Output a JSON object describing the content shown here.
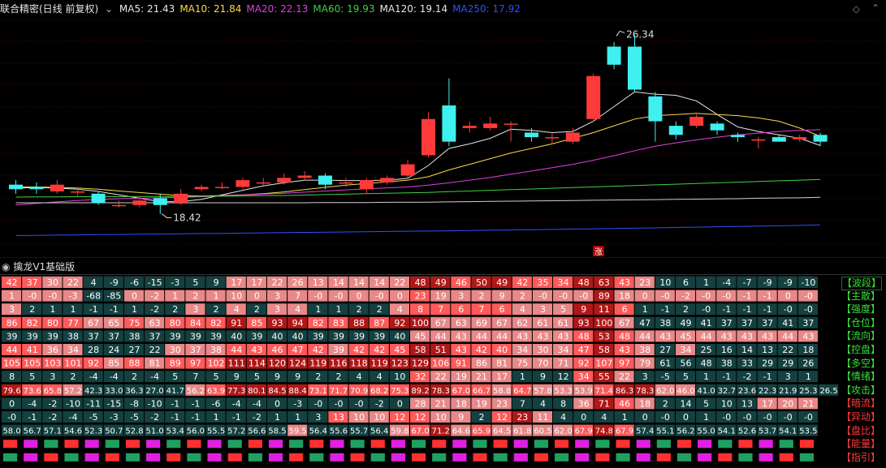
{
  "header": {
    "title": "联合精密(日线 前复权)",
    "ma": [
      {
        "label": "MA5: 21.43",
        "color": "#e6e6e6"
      },
      {
        "label": "MA10: 21.84",
        "color": "#ffd84a"
      },
      {
        "label": "MA20: 22.13",
        "color": "#e040e0"
      },
      {
        "label": "MA60: 19.93",
        "color": "#40d040"
      },
      {
        "label": "MA120: 19.14",
        "color": "#e6e6e6"
      },
      {
        "label": "MA250: 17.92",
        "color": "#3050ff"
      }
    ]
  },
  "chart_data": {
    "type": "candlestick",
    "price_range": [
      17.0,
      27.0
    ],
    "annotations": {
      "high": "26.34",
      "low": "18.42",
      "zhang": "涨"
    },
    "colors": {
      "up": "#ff3a3a",
      "down": "#3ff0f0"
    },
    "candles": [
      [
        19.7,
        19.5,
        19.9,
        19.3
      ],
      [
        19.6,
        19.5,
        19.8,
        19.3
      ],
      [
        19.4,
        19.7,
        19.9,
        19.3
      ],
      [
        19.4,
        19.4,
        19.6,
        19.2
      ],
      [
        19.3,
        18.9,
        19.4,
        18.8
      ],
      [
        18.8,
        18.8,
        19.0,
        18.7
      ],
      [
        18.8,
        19.0,
        19.2,
        18.7
      ],
      [
        19.1,
        18.8,
        19.3,
        18.4
      ],
      [
        18.9,
        19.3,
        19.5,
        18.8
      ],
      [
        19.5,
        19.6,
        19.7,
        19.4
      ],
      [
        19.6,
        19.6,
        19.8,
        19.5
      ],
      [
        19.6,
        19.9,
        20.0,
        19.5
      ],
      [
        19.8,
        19.8,
        20.0,
        19.6
      ],
      [
        19.8,
        20.0,
        20.2,
        19.7
      ],
      [
        20.0,
        20.1,
        20.3,
        19.9
      ],
      [
        20.1,
        19.7,
        20.2,
        19.5
      ],
      [
        19.8,
        19.8,
        20.0,
        19.6
      ],
      [
        19.5,
        19.9,
        20.0,
        19.3
      ],
      [
        19.8,
        20.0,
        20.1,
        19.7
      ],
      [
        20.1,
        20.6,
        20.8,
        20.0
      ],
      [
        21.0,
        22.6,
        22.9,
        20.9
      ],
      [
        23.2,
        21.6,
        24.4,
        21.4
      ],
      [
        22.2,
        22.3,
        22.5,
        22.0
      ],
      [
        22.2,
        22.4,
        22.7,
        22.1
      ],
      [
        22.4,
        22.4,
        22.5,
        21.6
      ],
      [
        22.0,
        21.8,
        22.2,
        21.6
      ],
      [
        21.8,
        21.8,
        22.0,
        21.5
      ],
      [
        21.6,
        22.0,
        22.2,
        21.5
      ],
      [
        22.6,
        24.5,
        24.6,
        22.5
      ],
      [
        25.8,
        25.0,
        26.0,
        24.8
      ],
      [
        25.8,
        23.9,
        26.3,
        23.8
      ],
      [
        23.6,
        22.5,
        23.8,
        21.6
      ],
      [
        22.3,
        21.9,
        22.5,
        21.7
      ],
      [
        22.3,
        22.7,
        22.8,
        22.2
      ],
      [
        22.4,
        22.1,
        22.5,
        21.9
      ],
      [
        21.9,
        21.8,
        22.0,
        21.6
      ],
      [
        21.7,
        21.7,
        21.8,
        21.3
      ],
      [
        21.8,
        21.6,
        21.9,
        21.6
      ],
      [
        21.7,
        21.8,
        21.9,
        21.6
      ],
      [
        21.9,
        21.6,
        22.0,
        21.4
      ]
    ],
    "ma_series": [
      {
        "name": "MA5",
        "color": "#e6e6e6",
        "values": [
          19.55,
          19.57,
          19.55,
          19.5,
          19.4,
          19.25,
          19.1,
          18.95,
          18.95,
          19.05,
          19.25,
          19.45,
          19.65,
          19.78,
          19.9,
          19.9,
          19.88,
          19.88,
          19.9,
          19.98,
          20.55,
          21.3,
          21.5,
          21.75,
          22.15,
          22.1,
          22.0,
          22.05,
          22.5,
          23.15,
          23.8,
          23.7,
          23.65,
          23.4,
          22.8,
          22.25,
          22.05,
          21.9,
          21.75,
          21.43
        ]
      },
      {
        "name": "MA10",
        "color": "#ffd84a",
        "values": [
          19.6,
          19.6,
          19.58,
          19.55,
          19.5,
          19.42,
          19.35,
          19.28,
          19.22,
          19.2,
          19.22,
          19.25,
          19.3,
          19.38,
          19.48,
          19.58,
          19.68,
          19.75,
          19.82,
          19.9,
          20.05,
          20.35,
          20.6,
          20.85,
          21.1,
          21.3,
          21.5,
          21.75,
          22.0,
          22.3,
          22.6,
          22.75,
          22.8,
          22.85,
          22.8,
          22.75,
          22.65,
          22.5,
          22.2,
          21.84
        ]
      },
      {
        "name": "MA20",
        "color": "#e040e0",
        "values": [
          18.8,
          18.87,
          18.94,
          19.0,
          19.05,
          19.08,
          19.1,
          19.12,
          19.14,
          19.17,
          19.2,
          19.24,
          19.28,
          19.32,
          19.37,
          19.42,
          19.47,
          19.52,
          19.56,
          19.6,
          19.68,
          19.78,
          19.9,
          20.02,
          20.16,
          20.3,
          20.45,
          20.6,
          20.78,
          20.98,
          21.2,
          21.4,
          21.55,
          21.68,
          21.8,
          21.9,
          21.98,
          22.05,
          22.1,
          22.13
        ]
      },
      {
        "name": "MA60",
        "color": "#40d040",
        "values": [
          19.15,
          19.16,
          19.16,
          19.17,
          19.17,
          19.17,
          19.18,
          19.18,
          19.18,
          19.19,
          19.19,
          19.2,
          19.21,
          19.22,
          19.24,
          19.26,
          19.28,
          19.3,
          19.32,
          19.34,
          19.36,
          19.39,
          19.42,
          19.45,
          19.48,
          19.51,
          19.54,
          19.57,
          19.6,
          19.63,
          19.66,
          19.69,
          19.72,
          19.75,
          19.78,
          19.81,
          19.84,
          19.87,
          19.9,
          19.93
        ]
      },
      {
        "name": "MA120",
        "color": "#cfcfcf",
        "values": [
          18.9,
          18.9,
          18.9,
          18.9,
          18.9,
          18.9,
          18.9,
          18.9,
          18.9,
          18.9,
          18.9,
          18.9,
          18.9,
          18.9,
          18.9,
          18.91,
          18.91,
          18.91,
          18.92,
          18.92,
          18.93,
          18.94,
          18.95,
          18.96,
          18.97,
          18.98,
          18.99,
          19.0,
          19.01,
          19.02,
          19.03,
          19.04,
          19.05,
          19.06,
          19.07,
          19.08,
          19.1,
          19.11,
          19.12,
          19.14
        ]
      },
      {
        "name": "MA250",
        "color": "#3050ff",
        "values": [
          17.45,
          17.46,
          17.47,
          17.48,
          17.49,
          17.5,
          17.51,
          17.52,
          17.53,
          17.54,
          17.55,
          17.56,
          17.57,
          17.58,
          17.59,
          17.6,
          17.61,
          17.62,
          17.63,
          17.64,
          17.65,
          17.66,
          17.67,
          17.69,
          17.7,
          17.71,
          17.72,
          17.74,
          17.75,
          17.76,
          17.78,
          17.79,
          17.81,
          17.82,
          17.84,
          17.85,
          17.87,
          17.88,
          17.9,
          17.92
        ]
      }
    ]
  },
  "indicator": {
    "title": "擒龙V1基础版",
    "rows": [
      {
        "label": "【波段】",
        "color": "#3adf3a",
        "values": [
          "42",
          "37",
          "30",
          "22",
          "4",
          "-9",
          "-6",
          "-15",
          "-3",
          "5",
          "9",
          "17",
          "17",
          "22",
          "26",
          "13",
          "14",
          "14",
          "14",
          "22",
          "48",
          "49",
          "46",
          "50",
          "49",
          "42",
          "35",
          "34",
          "48",
          "63",
          "43",
          "23",
          "10",
          "6",
          "1",
          "-4",
          "-7",
          "-9",
          "-9",
          "-10"
        ]
      },
      {
        "label": "【主散】",
        "color": "#3adf3a",
        "values": [
          "1",
          "-0",
          "-0",
          "-3",
          "-68",
          "-85",
          "0",
          "-2",
          "1",
          "2",
          "1",
          "10",
          "0",
          "3",
          "7",
          "-0",
          "-0",
          "0",
          "-0",
          "0",
          "23",
          "19",
          "3",
          "2",
          "9",
          "2",
          "-0",
          "-0",
          "-0",
          "89",
          "18",
          "0",
          "-0",
          "-2",
          "-0",
          "-0",
          "-1",
          "-1",
          "0",
          "-0"
        ]
      },
      {
        "label": "【强度】",
        "color": "#3adf3a",
        "values": [
          "3",
          "2",
          "1",
          "1",
          "-1",
          "-1",
          "1",
          "-2",
          "2",
          "3",
          "2",
          "4",
          "2",
          "3",
          "4",
          "1",
          "1",
          "2",
          "2",
          "4",
          "8",
          "7",
          "6",
          "7",
          "6",
          "4",
          "3",
          "5",
          "9",
          "11",
          "6",
          "1",
          "-1",
          "2",
          "-0",
          "-1",
          "-1",
          "-1",
          "-0",
          "-0"
        ]
      },
      {
        "label": "【仓位】",
        "color": "#3adf3a",
        "values": [
          "86",
          "82",
          "80",
          "77",
          "67",
          "65",
          "75",
          "63",
          "80",
          "84",
          "82",
          "91",
          "85",
          "93",
          "94",
          "82",
          "83",
          "88",
          "87",
          "92",
          "100",
          "67",
          "63",
          "69",
          "67",
          "62",
          "61",
          "61",
          "93",
          "100",
          "67",
          "47",
          "38",
          "49",
          "41",
          "37",
          "37",
          "37",
          "41",
          "37"
        ]
      },
      {
        "label": "【流向】",
        "color": "#3adf3a",
        "values": [
          "39",
          "39",
          "39",
          "38",
          "37",
          "37",
          "38",
          "37",
          "39",
          "39",
          "39",
          "40",
          "39",
          "40",
          "40",
          "39",
          "39",
          "39",
          "39",
          "40",
          "45",
          "44",
          "43",
          "44",
          "44",
          "43",
          "43",
          "43",
          "48",
          "53",
          "48",
          "44",
          "43",
          "45",
          "44",
          "43",
          "43",
          "43",
          "44",
          "43"
        ]
      },
      {
        "label": "【控盘】",
        "color": "#3adf3a",
        "values": [
          "44",
          "41",
          "36",
          "34",
          "28",
          "24",
          "27",
          "22",
          "30",
          "37",
          "38",
          "44",
          "43",
          "46",
          "47",
          "42",
          "39",
          "42",
          "42",
          "45",
          "58",
          "51",
          "43",
          "42",
          "40",
          "34",
          "30",
          "34",
          "47",
          "58",
          "43",
          "38",
          "27",
          "34",
          "25",
          "16",
          "14",
          "13",
          "22",
          "18"
        ]
      },
      {
        "label": "【多空】",
        "color": "#3adf3a",
        "values": [
          "105",
          "105",
          "103",
          "101",
          "92",
          "85",
          "88",
          "81",
          "89",
          "97",
          "102",
          "111",
          "114",
          "120",
          "124",
          "119",
          "116",
          "118",
          "119",
          "123",
          "129",
          "106",
          "91",
          "86",
          "81",
          "75",
          "70",
          "71",
          "92",
          "107",
          "97",
          "79",
          "61",
          "56",
          "48",
          "38",
          "33",
          "29",
          "29",
          "26"
        ]
      },
      {
        "label": "【情绪】",
        "color": "#3adf3a",
        "values": [
          "8",
          "5",
          "3",
          "2",
          "-4",
          "-4",
          "2",
          "-4",
          "5",
          "7",
          "5",
          "9",
          "5",
          "9",
          "9",
          "2",
          "2",
          "4",
          "4",
          "10",
          "32",
          "22",
          "19",
          "21",
          "17",
          "1",
          "9",
          "12",
          "34",
          "55",
          "22",
          "3",
          "-5",
          "5",
          "1",
          "-1",
          "-2",
          "-1",
          "3",
          "1"
        ]
      },
      {
        "label": "【攻击】",
        "color": "#3adf3a",
        "values": [
          "79.6",
          "73.6",
          "65.8",
          "57.2",
          "42.3",
          "33.0",
          "36.3",
          "27.0",
          "41.7",
          "56.2",
          "63.9",
          "77.3",
          "80.1",
          "84.5",
          "88.4",
          "73.1",
          "71.7",
          "70.9",
          "68.2",
          "75.3",
          "89.2",
          "78.3",
          "67.0",
          "66.7",
          "58.8",
          "64.7",
          "57.8",
          "53.3",
          "53.9",
          "71.4",
          "86.3",
          "78.3",
          "62.0",
          "46.0",
          "41.0",
          "32.7",
          "23.6",
          "22.3",
          "21.9",
          "25.3",
          "26.5"
        ]
      },
      {
        "label": "【暗流】",
        "color": "#ff3a3a",
        "values": [
          "0",
          "-4",
          "-2",
          "-10",
          "-11",
          "-15",
          "-8",
          "-10",
          "-1",
          "-1",
          "-6",
          "-4",
          "-4",
          "0",
          "-3",
          "-0",
          "-0",
          "-0",
          "-2",
          "0",
          "28",
          "21",
          "18",
          "19",
          "23",
          "7",
          "4",
          "8",
          "36",
          "71",
          "46",
          "18",
          "2",
          "14",
          "5",
          "10",
          "13",
          "17",
          "20",
          "21"
        ]
      },
      {
        "label": "【异动】",
        "color": "#ff3a3a",
        "values": [
          "-0",
          "-1",
          "-2",
          "-4",
          "-5",
          "-3",
          "-5",
          "-2",
          "-1",
          "-1",
          "1",
          "-1",
          "-2",
          "1",
          "1",
          "3",
          "13",
          "10",
          "10",
          "12",
          "12",
          "10",
          "9",
          "2",
          "12",
          "23",
          "11",
          "4",
          "0",
          "4",
          "1",
          "0",
          "-0",
          "0",
          "1",
          "-0",
          "-0",
          "-0",
          "-0",
          "-0"
        ]
      },
      {
        "label": "【盘比】",
        "color": "#ff3a3a",
        "values": [
          "58.0",
          "56.7",
          "57.1",
          "54.6",
          "52.3",
          "50.7",
          "52.8",
          "51.0",
          "53.4",
          "56.0",
          "55.5",
          "57.2",
          "56.6",
          "58.5",
          "59.5",
          "56.4",
          "55.6",
          "55.7",
          "56.4",
          "59.8",
          "67.0",
          "71.2",
          "64.6",
          "65.9",
          "64.5",
          "61.8",
          "60.5",
          "62.0",
          "67.9",
          "74.8",
          "67.9",
          "57.4",
          "55.1",
          "56.2",
          "55.0",
          "54.1",
          "52.6",
          "53.7",
          "54.1",
          "53.5"
        ]
      },
      {
        "label": "【能量】",
        "color": "#ff3a3a",
        "values": []
      },
      {
        "label": "【指引】",
        "color": "#ff3a3a",
        "values": []
      }
    ]
  }
}
